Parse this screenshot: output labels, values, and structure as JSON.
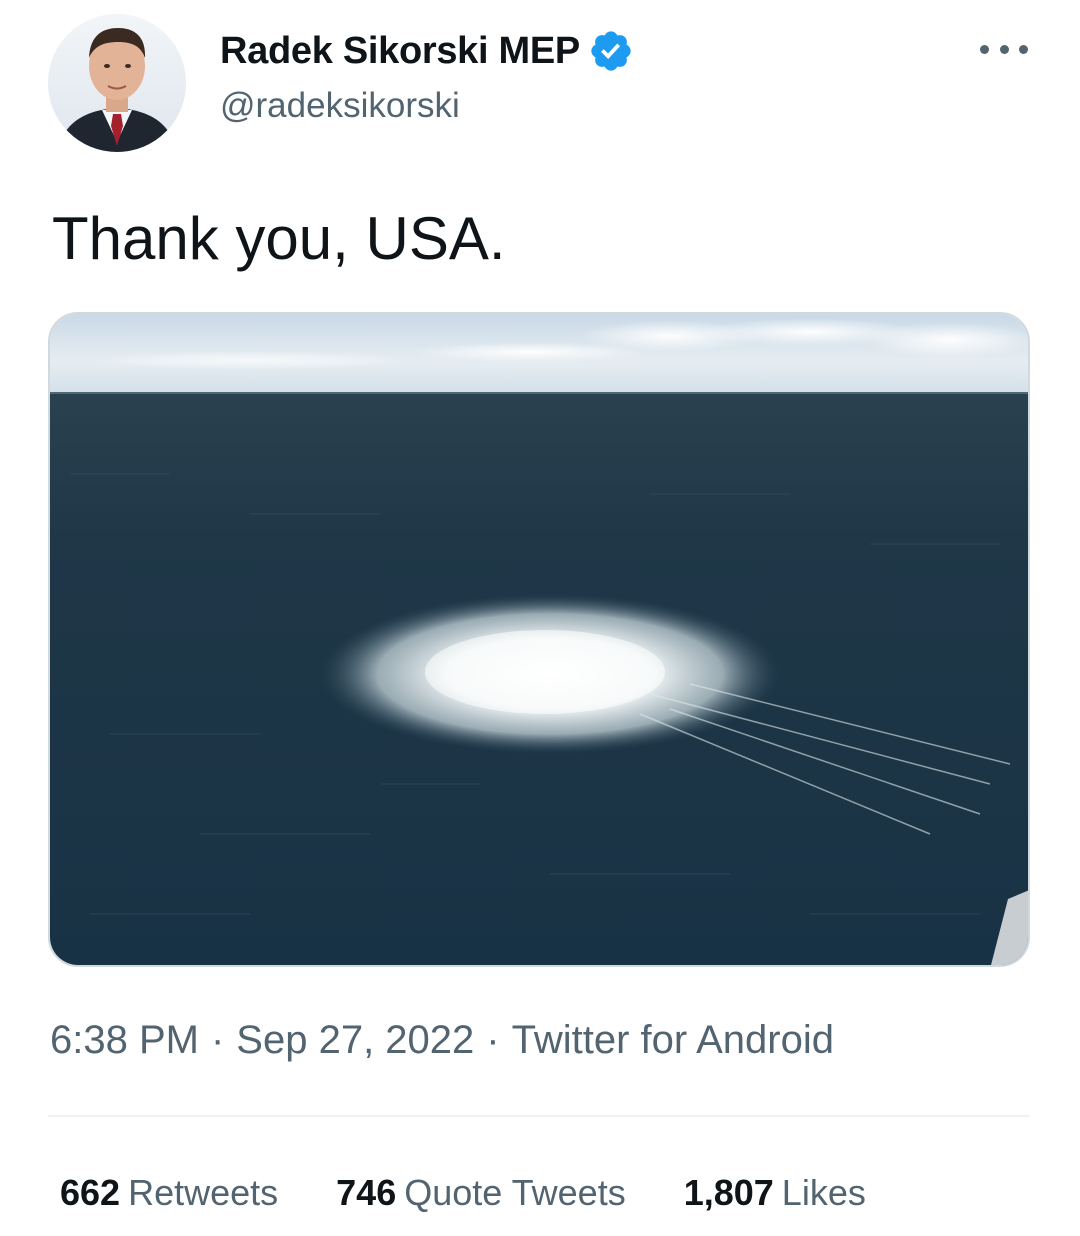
{
  "author": {
    "display_name": "Radek Sikorski MEP",
    "handle": "@radeksikorski",
    "verified": true
  },
  "tweet": {
    "text": "Thank you, USA.",
    "time": "6:38 PM",
    "date": "Sep 27, 2022",
    "source": "Twitter for Android",
    "separator": "·"
  },
  "stats": {
    "retweets_count": "662",
    "retweets_label": "Retweets",
    "quotes_count": "746",
    "quotes_label": "Quote Tweets",
    "likes_count": "1,807",
    "likes_label": "Likes"
  },
  "icons": {
    "verified": "verified-badge-icon",
    "more": "more-options-icon"
  },
  "colors": {
    "verified_blue": "#1d9bf0",
    "secondary_text": "#536471",
    "primary_text": "#0f1419"
  }
}
